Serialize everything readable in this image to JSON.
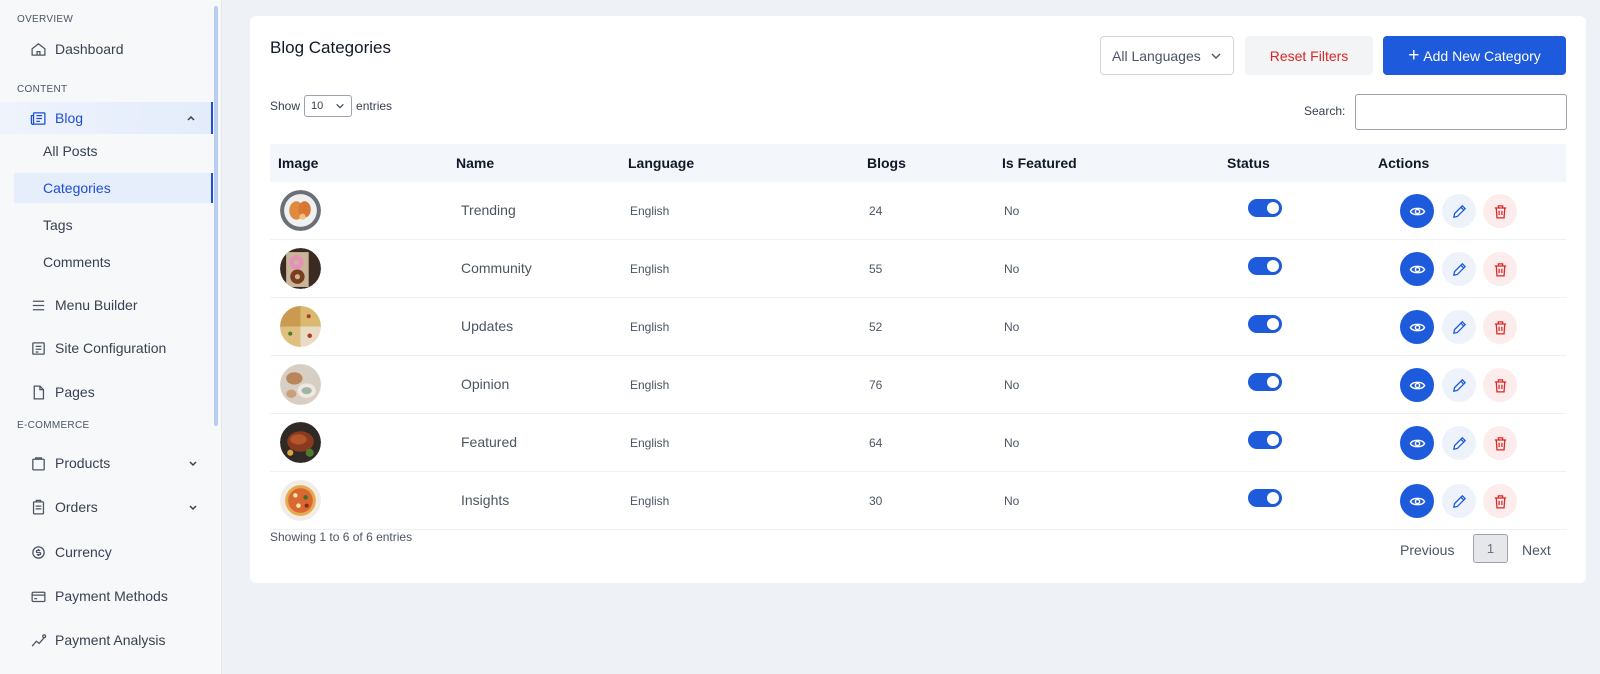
{
  "sidebar": {
    "sections": {
      "overview": "OVERVIEW",
      "content": "CONTENT",
      "ecommerce": "E-COMMERCE"
    },
    "items": {
      "dashboard": "Dashboard",
      "blog": "Blog",
      "menu_builder": "Menu Builder",
      "site_configuration": "Site Configuration",
      "pages": "Pages",
      "products": "Products",
      "orders": "Orders",
      "currency": "Currency",
      "payment_methods": "Payment Methods",
      "payment_analysis": "Payment Analysis"
    },
    "blog_sub": {
      "all_posts": "All Posts",
      "categories": "Categories",
      "tags": "Tags",
      "comments": "Comments"
    },
    "active_item": "Blog",
    "active_sub": "Categories"
  },
  "main": {
    "title": "Blog Categories",
    "language_filter": "All Languages",
    "reset_label": "Reset Filters",
    "add_label": "Add New Category",
    "show_label": "Show",
    "entries_value": "10",
    "entries_label": "entries",
    "search_label": "Search:",
    "search_value": ""
  },
  "table": {
    "headers": {
      "image": "Image",
      "name": "Name",
      "language": "Language",
      "blogs": "Blogs",
      "featured": "Is Featured",
      "status": "Status",
      "actions": "Actions"
    },
    "rows": [
      {
        "name": "Trending",
        "language": "English",
        "blogs": "24",
        "featured": "No",
        "status": true,
        "image_icon": "food-plate-icon"
      },
      {
        "name": "Community",
        "language": "English",
        "blogs": "55",
        "featured": "No",
        "status": true,
        "image_icon": "donut-icon"
      },
      {
        "name": "Updates",
        "language": "English",
        "blogs": "52",
        "featured": "No",
        "status": true,
        "image_icon": "pizza-icon"
      },
      {
        "name": "Opinion",
        "language": "English",
        "blogs": "76",
        "featured": "No",
        "status": true,
        "image_icon": "bread-icon"
      },
      {
        "name": "Featured",
        "language": "English",
        "blogs": "64",
        "featured": "No",
        "status": true,
        "image_icon": "steak-icon"
      },
      {
        "name": "Insights",
        "language": "English",
        "blogs": "30",
        "featured": "No",
        "status": true,
        "image_icon": "pizza-icon"
      }
    ]
  },
  "footer": {
    "info": "Showing 1 to 6 of 6 entries",
    "previous": "Previous",
    "page": "1",
    "next": "Next"
  },
  "colors": {
    "primary": "#1d5adc",
    "danger": "#dc2626",
    "background": "#eef1f5"
  }
}
